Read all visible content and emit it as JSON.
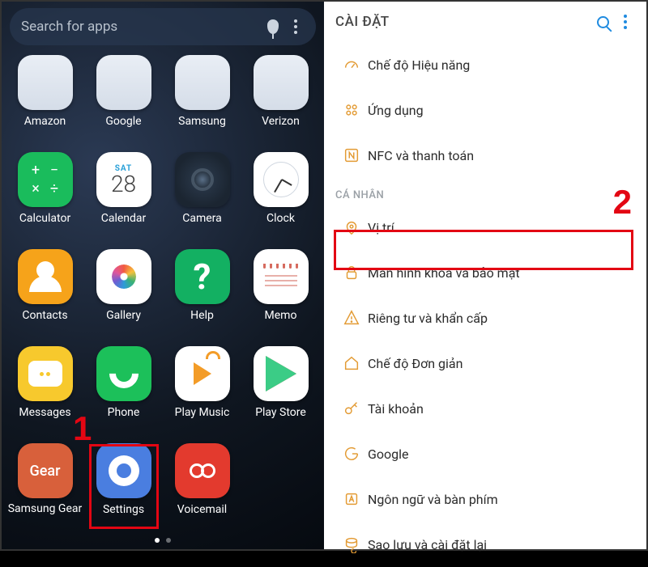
{
  "left": {
    "search_placeholder": "Search for apps",
    "apps": [
      {
        "label": "Amazon"
      },
      {
        "label": "Google"
      },
      {
        "label": "Samsung"
      },
      {
        "label": "Verizon"
      },
      {
        "label": "Calculator"
      },
      {
        "label": "Calendar",
        "weekday_short": "SAT",
        "day": "28"
      },
      {
        "label": "Camera"
      },
      {
        "label": "Clock"
      },
      {
        "label": "Contacts"
      },
      {
        "label": "Gallery"
      },
      {
        "label": "Help"
      },
      {
        "label": "Memo"
      },
      {
        "label": "Messages"
      },
      {
        "label": "Phone"
      },
      {
        "label": "Play Music"
      },
      {
        "label": "Play Store"
      },
      {
        "label": "Samsung Gear",
        "badge": "Gear"
      },
      {
        "label": "Settings"
      },
      {
        "label": "Voicemail"
      }
    ]
  },
  "right": {
    "title": "CÀI ĐẶT",
    "items_top": [
      {
        "icon": "gauge",
        "label": "Chế độ Hiệu năng"
      },
      {
        "icon": "grid",
        "label": "Ứng dụng"
      },
      {
        "icon": "nfc",
        "label": "NFC và thanh toán"
      }
    ],
    "section_personal": "CÁ NHÂN",
    "items_personal": [
      {
        "icon": "location",
        "label": "Vị trí"
      },
      {
        "icon": "lock",
        "label": "Màn hình khóa và bảo mật"
      },
      {
        "icon": "alert",
        "label": "Riêng tư và khẩn cấp"
      },
      {
        "icon": "home",
        "label": "Chế độ Đơn giản"
      },
      {
        "icon": "key",
        "label": "Tài khoản"
      },
      {
        "icon": "google",
        "label": "Google"
      },
      {
        "icon": "lang",
        "label": "Ngôn ngữ và bàn phím"
      },
      {
        "icon": "backup",
        "label": "Sao lưu và cài đặt lại"
      }
    ]
  },
  "annotations": {
    "one": "1",
    "two": "2"
  }
}
